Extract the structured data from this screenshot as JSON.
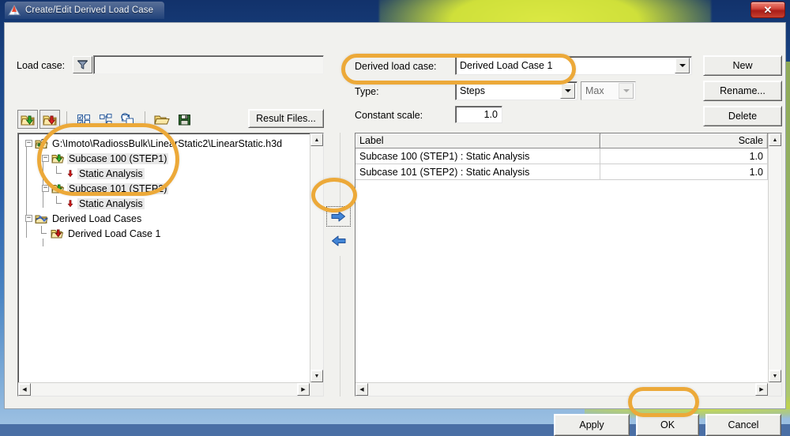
{
  "window": {
    "title": "Create/Edit Derived Load Case",
    "title_icon": "hypermesh-app-icon",
    "close_label": "✕"
  },
  "left": {
    "loadcase_label": "Load case:",
    "loadcase_value": "",
    "loadcase_placeholder": "",
    "filter_icon": "filter-funnel-icon",
    "toolbar": [
      {
        "name": "import-subcase-green-icon",
        "title": "Import Subcase"
      },
      {
        "name": "import-subcase-red-icon",
        "title": "Import Subcase"
      },
      {
        "name": "select-all-icon",
        "title": "Select All"
      },
      {
        "name": "collapse-all-icon",
        "title": "Collapse All"
      },
      {
        "name": "refresh-results-icon",
        "title": "Refresh"
      },
      {
        "name": "open-folder-icon",
        "title": "Open"
      },
      {
        "name": "save-floppy-icon",
        "title": "Save"
      }
    ],
    "result_files_label": "Result Files...",
    "tree": [
      {
        "label": "G:\\Imoto\\RadiossBulk\\LinearStatic2\\LinearStatic.h3d",
        "depth": 0,
        "icon": "h3d-result-file-icon",
        "expander": "-",
        "selected": false
      },
      {
        "label": "Subcase 100 (STEP1)",
        "depth": 1,
        "icon": "subcase-folder-green-icon",
        "expander": "-",
        "selected": true
      },
      {
        "label": "Static Analysis",
        "depth": 2,
        "icon": "static-analysis-arrow-icon",
        "expander": "",
        "selected": true
      },
      {
        "label": "Subcase 101 (STEP2)",
        "depth": 1,
        "icon": "subcase-folder-green-icon",
        "expander": "-",
        "selected": true
      },
      {
        "label": "Static Analysis",
        "depth": 2,
        "icon": "static-analysis-arrow-icon",
        "expander": "",
        "selected": true
      },
      {
        "label": "Derived Load Cases",
        "depth": 0,
        "icon": "derived-load-cases-icon",
        "expander": "-",
        "selected": false
      },
      {
        "label": "Derived Load Case 1",
        "depth": 1,
        "icon": "derived-load-case-folder-icon",
        "expander": "",
        "selected": false
      }
    ]
  },
  "transfer": {
    "add_icon": "arrow-right-icon",
    "remove_icon": "arrow-left-icon"
  },
  "right": {
    "derived_load_case_label": "Derived load case:",
    "derived_load_case_value": "Derived Load Case 1",
    "type_label": "Type:",
    "type_value": "Steps",
    "max_value": "Max",
    "constant_scale_label": "Constant scale:",
    "constant_scale_value": "1.0",
    "buttons": {
      "new": "New",
      "rename": "Rename...",
      "delete": "Delete"
    },
    "table": {
      "columns": [
        "Label",
        "Scale"
      ],
      "rows": [
        {
          "label": "Subcase 100 (STEP1) : Static Analysis",
          "scale": "1.0"
        },
        {
          "label": "Subcase 101 (STEP2) : Static Analysis",
          "scale": "1.0"
        }
      ]
    }
  },
  "footer": {
    "apply": "Apply",
    "ok": "OK",
    "cancel": "Cancel"
  },
  "scrollbars": {
    "up": "▲",
    "down": "▼",
    "left": "◀",
    "right": "▶"
  },
  "colors": {
    "highlight_ring": "#eca939",
    "titlebar_blue": "#1b4788",
    "aurora_green": "#cfe03a",
    "close_red": "#c8402f",
    "dialog_face": "#f1f1ee"
  }
}
